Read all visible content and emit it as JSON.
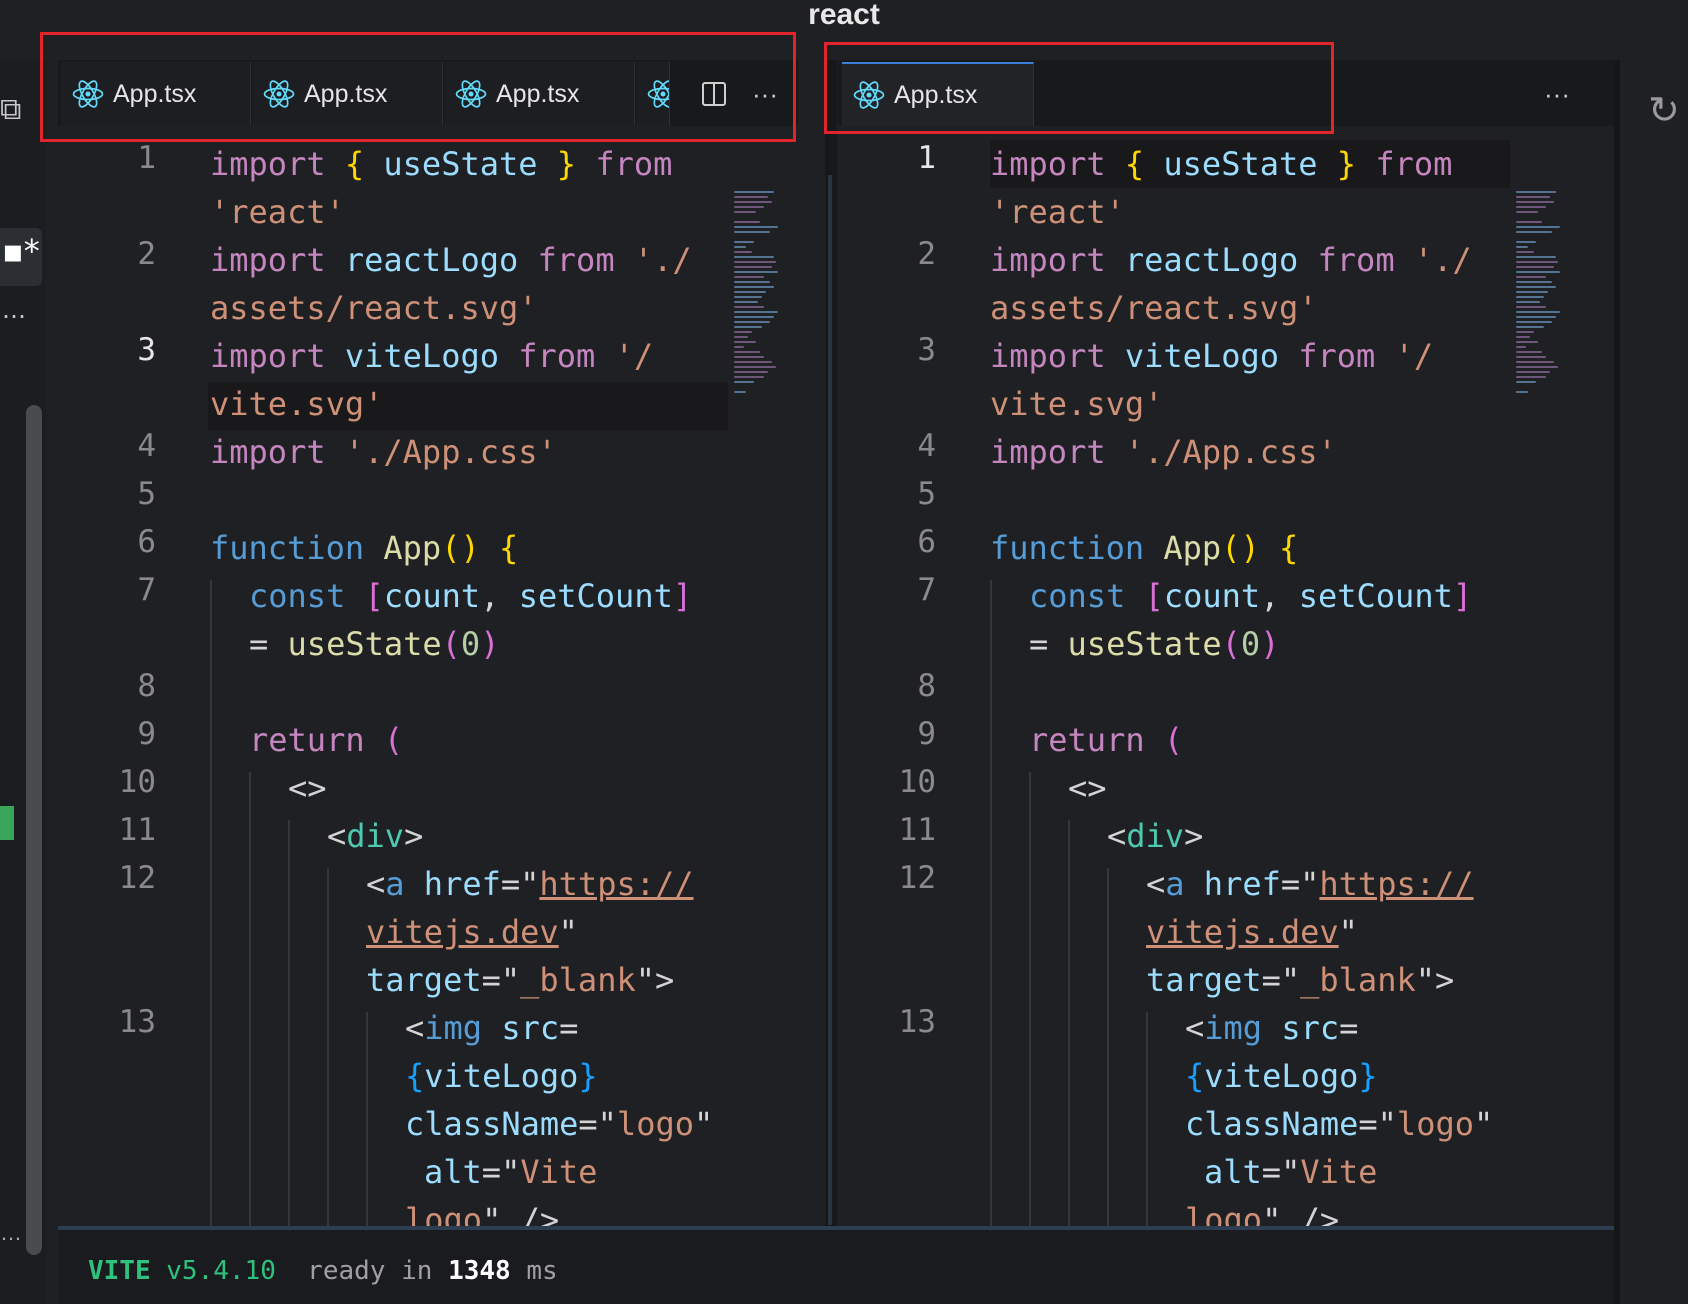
{
  "window": {
    "title": "react"
  },
  "activity": {
    "active_symbol": "▪*",
    "more": "…",
    "bottom_more": "…"
  },
  "left_group": {
    "tabs": [
      {
        "label": "App.tsx"
      },
      {
        "label": "App.tsx"
      },
      {
        "label": "App.tsx"
      }
    ],
    "more_label": "···"
  },
  "right_group": {
    "tabs": [
      {
        "label": "App.tsx"
      }
    ],
    "more_label": "···"
  },
  "code": {
    "line_numbers": [
      "1",
      "2",
      "3",
      "4",
      "5",
      "6",
      "7",
      "8",
      "9",
      "10",
      "11",
      "12",
      "13"
    ],
    "lines": [
      "import { useState } from 'react'",
      "import reactLogo from './assets/react.svg'",
      "import viteLogo from '/vite.svg'",
      "import './App.css'",
      "",
      "function App() {",
      "  const [count, setCount] = useState(0)",
      "",
      "  return (",
      "    <>",
      "      <div>",
      "        <a href=\"https://vitejs.dev\" target=\"_blank\">",
      "          <img src={viteLogo} className=\"logo\" alt=\"Vite logo\" />"
    ]
  },
  "terminal": {
    "vite": "VITE",
    "version": "v5.4.10",
    "ready_text": "ready in",
    "ready_ms": "1348",
    "ms_unit": "ms"
  },
  "colors": {
    "accent_tab": "#3b7fd9",
    "annotation": "#e3242b",
    "terminal_green": "#2ec27e"
  }
}
